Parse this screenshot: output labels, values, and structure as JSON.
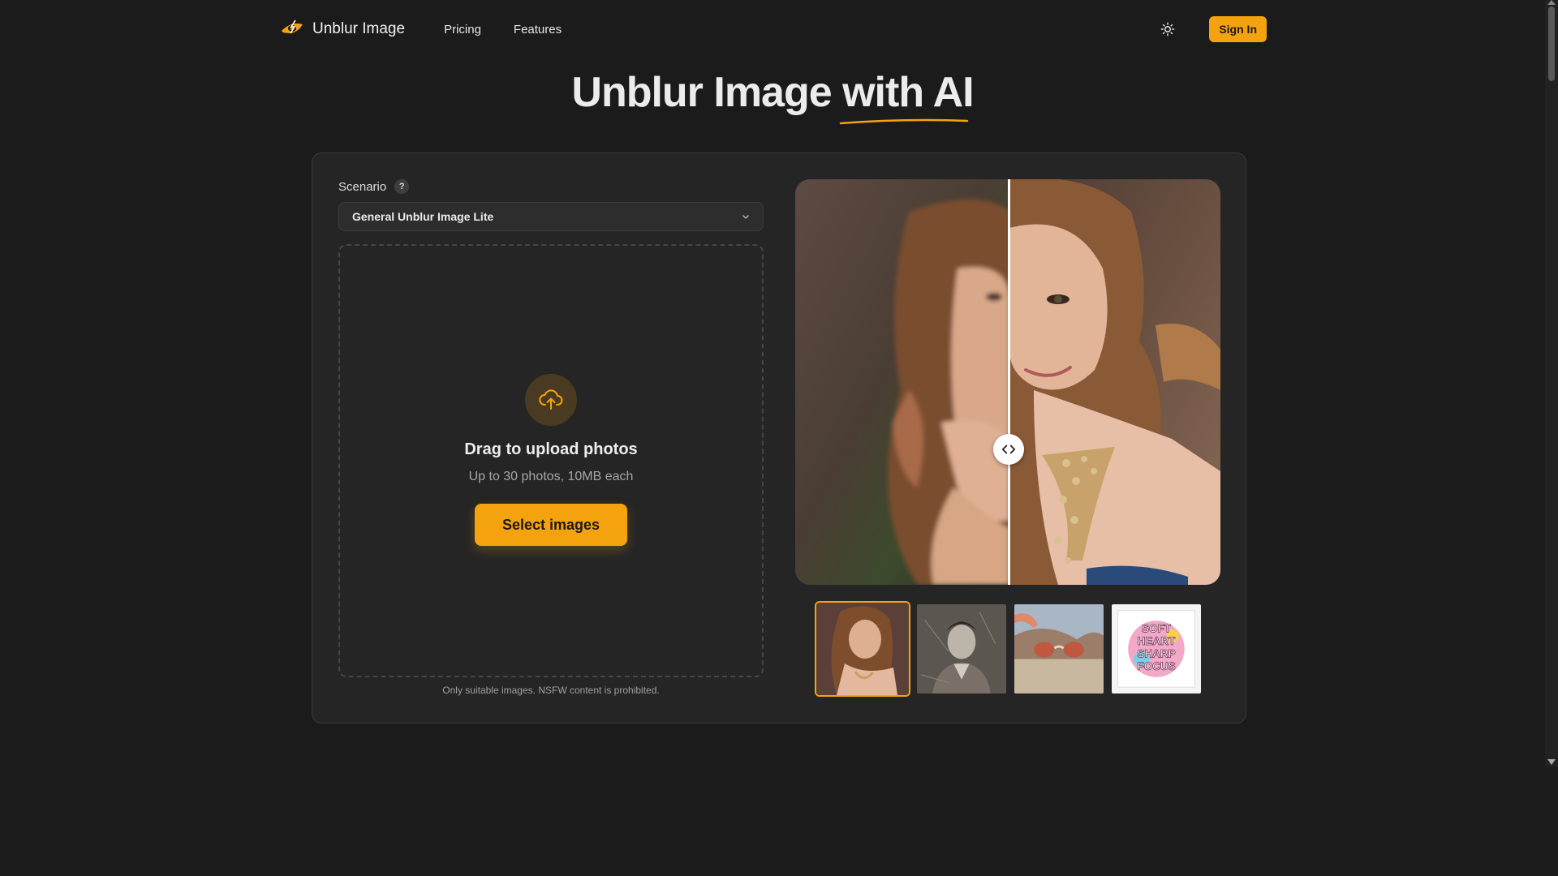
{
  "header": {
    "brand": "Unblur Image",
    "nav": [
      "Pricing",
      "Features"
    ],
    "sign_in": "Sign In",
    "logo_icon": "eye-lightning-logo",
    "theme_icon": "sun-icon"
  },
  "hero": {
    "title_main": "Unblur Image ",
    "title_accent": "with AI"
  },
  "form": {
    "scenario_label": "Scenario",
    "help": "?",
    "scenario_value": "General Unblur Image Lite"
  },
  "upload": {
    "title": "Drag to upload photos",
    "subtitle": "Up to 30 photos, 10MB each",
    "button": "Select images",
    "note": "Only suitable images. NSFW content is prohibited."
  },
  "samples": {
    "selected_index": 0,
    "thumb_4_text": [
      "SOFT",
      "HEART",
      "SHARP",
      "FOCUS"
    ]
  },
  "colors": {
    "accent": "#f5a20f",
    "background": "#1a1a1a",
    "card": "#252525"
  }
}
